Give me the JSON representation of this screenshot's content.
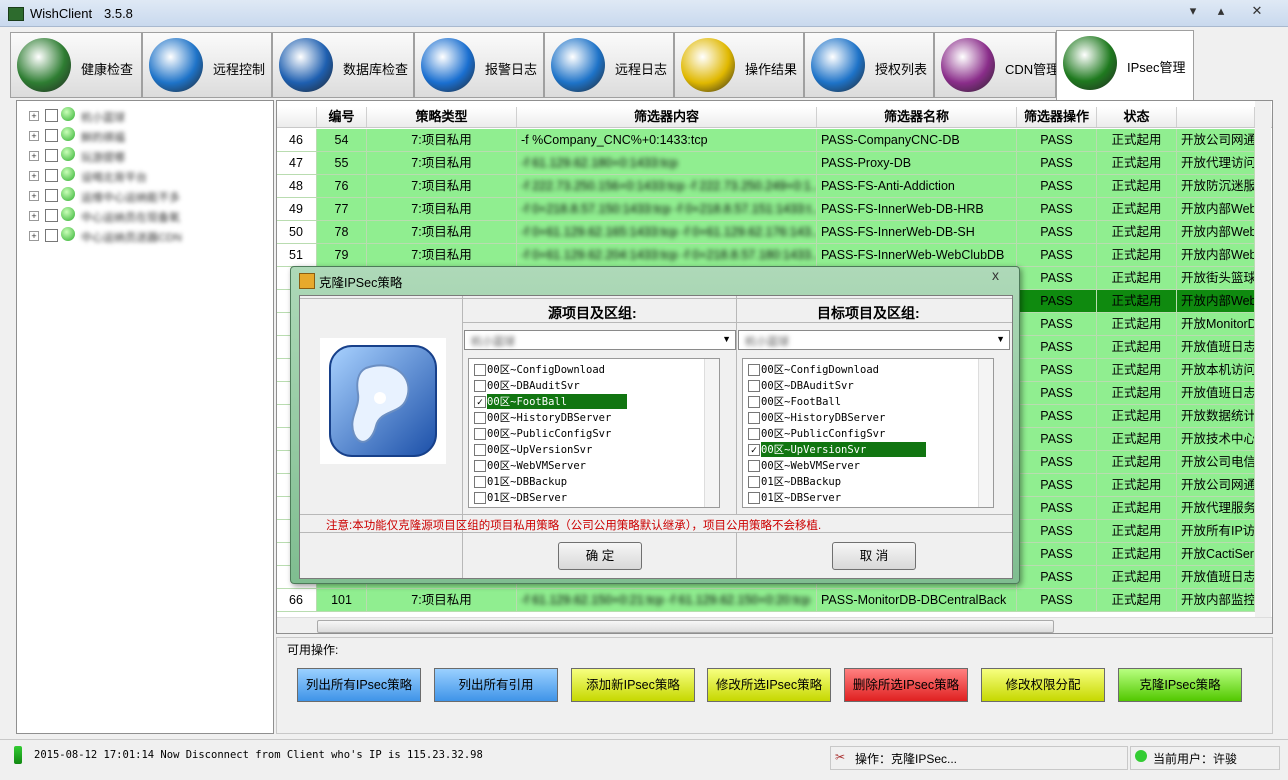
{
  "window": {
    "title": "WishClient",
    "version": "3.5.8",
    "buttons": [
      "▾",
      "▴",
      "✕"
    ]
  },
  "tabs": [
    {
      "label": "健康检查",
      "icon": "radar-icon",
      "color": "#2e7d32"
    },
    {
      "label": "远程控制",
      "icon": "globe-icon",
      "color": "#1e73c8"
    },
    {
      "label": "数据库检查",
      "icon": "database-icon",
      "color": "#1e5fb0"
    },
    {
      "label": "报警日志",
      "icon": "megaphone-icon",
      "color": "#1a6fd0"
    },
    {
      "label": "远程日志",
      "icon": "tools-icon",
      "color": "#1e73c8"
    },
    {
      "label": "操作结果",
      "icon": "hourglass-icon",
      "color": "#e0b800"
    },
    {
      "label": "授权列表",
      "icon": "shield-icon",
      "color": "#1e73c8"
    },
    {
      "label": "CDN管理",
      "icon": "yinyang-icon",
      "color": "#8a2d8a"
    },
    {
      "label": "IPsec管理",
      "icon": "yinyang-green-icon",
      "color": "#1f7a1f"
    }
  ],
  "tree": {
    "items": [
      "杭小蓝球",
      "鲜的祺福",
      "玩游提哪",
      "设喝北背平台",
      "运维中心运纳能不多",
      "中心运纳员在现备氧",
      "中心运纳员送器CDN"
    ]
  },
  "grid": {
    "columns": [
      "",
      "编号",
      "策略类型",
      "筛选器内容",
      "筛选器名称",
      "筛选器操作",
      "状态",
      ""
    ],
    "rows": [
      {
        "row": "46",
        "id": "54",
        "type": "7:项目私用",
        "content": "-f %Company_CNC%+0:1433:tcp",
        "name": "PASS-CompanyCNC-DB",
        "op": "PASS",
        "status": "正式起用",
        "desc": "开放公司网通"
      },
      {
        "row": "47",
        "id": "55",
        "type": "7:项目私用",
        "content": "-f 61.129.62.180+0:1433:tcp",
        "name": "PASS-Proxy-DB",
        "op": "PASS",
        "status": "正式起用",
        "desc": "开放代理访问"
      },
      {
        "row": "48",
        "id": "76",
        "type": "7:项目私用",
        "content": "-f 222.73.250.156+0:1433:tcp -f 222.73.250.249+0:1...",
        "name": "PASS-FS-Anti-Addiction",
        "op": "PASS",
        "status": "正式起用",
        "desc": "开放防沉迷服"
      },
      {
        "row": "49",
        "id": "77",
        "type": "7:项目私用",
        "content": "-f 0+218.8.57.150:1433:tcp -f 0+218.8.57.151:1433:t...",
        "name": "PASS-FS-InnerWeb-DB-HRB",
        "op": "PASS",
        "status": "正式起用",
        "desc": "开放内部Web"
      },
      {
        "row": "50",
        "id": "78",
        "type": "7:项目私用",
        "content": "-f 0+61.129.62.165:1433:tcp -f 0+61.129.62.176:143...",
        "name": "PASS-FS-InnerWeb-DB-SH",
        "op": "PASS",
        "status": "正式起用",
        "desc": "开放内部Web"
      },
      {
        "row": "51",
        "id": "79",
        "type": "7:项目私用",
        "content": "-f 0+61.129.62.204:1433:tcp -f 0+218.8.57.180:1433...",
        "name": "PASS-FS-InnerWeb-WebClubDB",
        "op": "PASS",
        "status": "正式起用",
        "desc": "开放内部Web"
      },
      {
        "row": "",
        "id": "",
        "type": "",
        "content": "",
        "name": "",
        "op": "PASS",
        "status": "正式起用",
        "desc": "开放街头篮球"
      },
      {
        "row": "",
        "id": "",
        "type": "",
        "content": "",
        "name": "",
        "op": "PASS",
        "status": "正式起用",
        "desc": "开放内部Web",
        "selected": true
      },
      {
        "row": "",
        "id": "",
        "type": "",
        "content": "",
        "name": "",
        "op": "PASS",
        "status": "正式起用",
        "desc": "开放MonitorD"
      },
      {
        "row": "",
        "id": "",
        "type": "",
        "content": "",
        "name": "",
        "op": "PASS",
        "status": "正式起用",
        "desc": "开放值班日志"
      },
      {
        "row": "",
        "id": "",
        "type": "",
        "content": "",
        "name": "",
        "op": "PASS",
        "status": "正式起用",
        "desc": "开放本机访问"
      },
      {
        "row": "",
        "id": "",
        "type": "",
        "content": "",
        "name": "",
        "op": "PASS",
        "status": "正式起用",
        "desc": "开放值班日志"
      },
      {
        "row": "",
        "id": "",
        "type": "",
        "content": "",
        "name": "",
        "op": "PASS",
        "status": "正式起用",
        "desc": "开放数据统计"
      },
      {
        "row": "",
        "id": "",
        "type": "",
        "content": "",
        "name": "",
        "op": "PASS",
        "status": "正式起用",
        "desc": "开放技术中心"
      },
      {
        "row": "",
        "id": "",
        "type": "",
        "content": "",
        "name": "",
        "op": "PASS",
        "status": "正式起用",
        "desc": "开放公司电信"
      },
      {
        "row": "",
        "id": "",
        "type": "",
        "content": "",
        "name": "",
        "op": "PASS",
        "status": "正式起用",
        "desc": "开放公司网通"
      },
      {
        "row": "",
        "id": "",
        "type": "",
        "content": "",
        "name": "",
        "op": "PASS",
        "status": "正式起用",
        "desc": "开放代理服务"
      },
      {
        "row": "",
        "id": "",
        "type": "",
        "content": "",
        "name": "",
        "op": "PASS",
        "status": "正式起用",
        "desc": "开放所有IP访"
      },
      {
        "row": "",
        "id": "",
        "type": "",
        "content": "",
        "name": "",
        "op": "PASS",
        "status": "正式起用",
        "desc": "开放CactiServ"
      },
      {
        "row": "",
        "id": "",
        "type": "",
        "content": "",
        "name": "",
        "op": "PASS",
        "status": "正式起用",
        "desc": "开放值班日志"
      },
      {
        "row": "66",
        "id": "101",
        "type": "7:项目私用",
        "content": "-f 61.129.62.150+0:21:tcp -f 61.129.62.150+0:20:tcp",
        "name": "PASS-MonitorDB-DBCentralBack",
        "op": "PASS",
        "status": "正式起用",
        "desc": "开放内部监控"
      }
    ]
  },
  "ops": {
    "label": "可用操作:",
    "buttons": [
      {
        "label": "列出所有IPsec策略",
        "style": "blue"
      },
      {
        "label": "列出所有引用",
        "style": "blue"
      },
      {
        "label": "添加新IPsec策略",
        "style": "yellow"
      },
      {
        "label": "修改所选IPsec策略",
        "style": "yellow"
      },
      {
        "label": "删除所选IPsec策略",
        "style": "red"
      },
      {
        "label": "修改权限分配",
        "style": "yellow"
      },
      {
        "label": "克隆IPsec策略",
        "style": "green"
      }
    ]
  },
  "status": {
    "log": "2015-08-12 17:01:14  Now Disconnect from Client who's IP is 115.23.32.98",
    "operation": "操作：克隆IPSec...",
    "user": "当前用户：许骏"
  },
  "dialog": {
    "title": "克隆IPSec策略",
    "source_header": "源项目及区组:",
    "target_header": "目标项目及区组:",
    "source_combo": "杭小蓝球",
    "target_combo": "杭小蓝球",
    "items": [
      "00区~ConfigDownload",
      "00区~DBAuditSvr",
      "00区~FootBall",
      "00区~HistoryDBServer",
      "00区~PublicConfigSvr",
      "00区~UpVersionSvr",
      "00区~WebVMServer",
      "01区~DBBackup",
      "01区~DBServer"
    ],
    "source_selected": 2,
    "target_selected": 5,
    "note": "注意:本功能仅克隆源项目区组的项目私用策略（公司公用策略默认继承），项目公用策略不会移植.",
    "ok": "确  定",
    "cancel": "取  消"
  }
}
